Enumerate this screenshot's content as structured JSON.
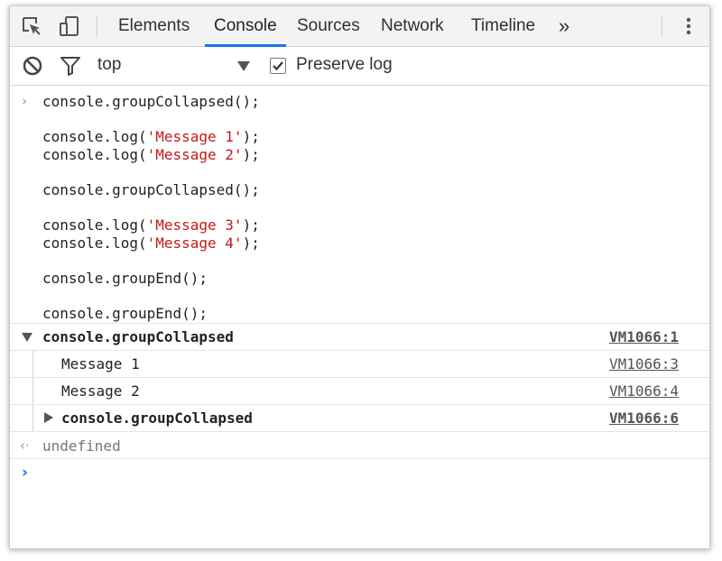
{
  "tabs": {
    "elements": "Elements",
    "console": "Console",
    "sources": "Sources",
    "network": "Network",
    "timeline": "Timeline",
    "more": "»"
  },
  "toolbar": {
    "context": "top",
    "preserve_log_label": "Preserve log",
    "preserve_log_checked": true
  },
  "input": {
    "l1": "console.groupCollapsed();",
    "l2_pre": "console.log(",
    "l2_str": "'Message 1'",
    "l2_post": ");",
    "l3_pre": "console.log(",
    "l3_str": "'Message 2'",
    "l3_post": ");",
    "l4": "console.groupCollapsed();",
    "l5_pre": "console.log(",
    "l5_str": "'Message 3'",
    "l5_post": ");",
    "l6_pre": "console.log(",
    "l6_str": "'Message 4'",
    "l6_post": ");",
    "l7": "console.groupEnd();",
    "l8": "console.groupEnd();"
  },
  "output": [
    {
      "text": "console.groupCollapsed",
      "source": "VM1066:1"
    },
    {
      "text": "Message 1",
      "source": "VM1066:3"
    },
    {
      "text": "Message 2",
      "source": "VM1066:4"
    },
    {
      "text": "console.groupCollapsed",
      "source": "VM1066:6"
    }
  ],
  "result": "undefined",
  "icons": {
    "inspect": "inspect-element-icon",
    "device": "device-mode-icon",
    "clear": "clear-console-icon",
    "filter": "filter-icon",
    "menu": "kebab-menu-icon"
  }
}
